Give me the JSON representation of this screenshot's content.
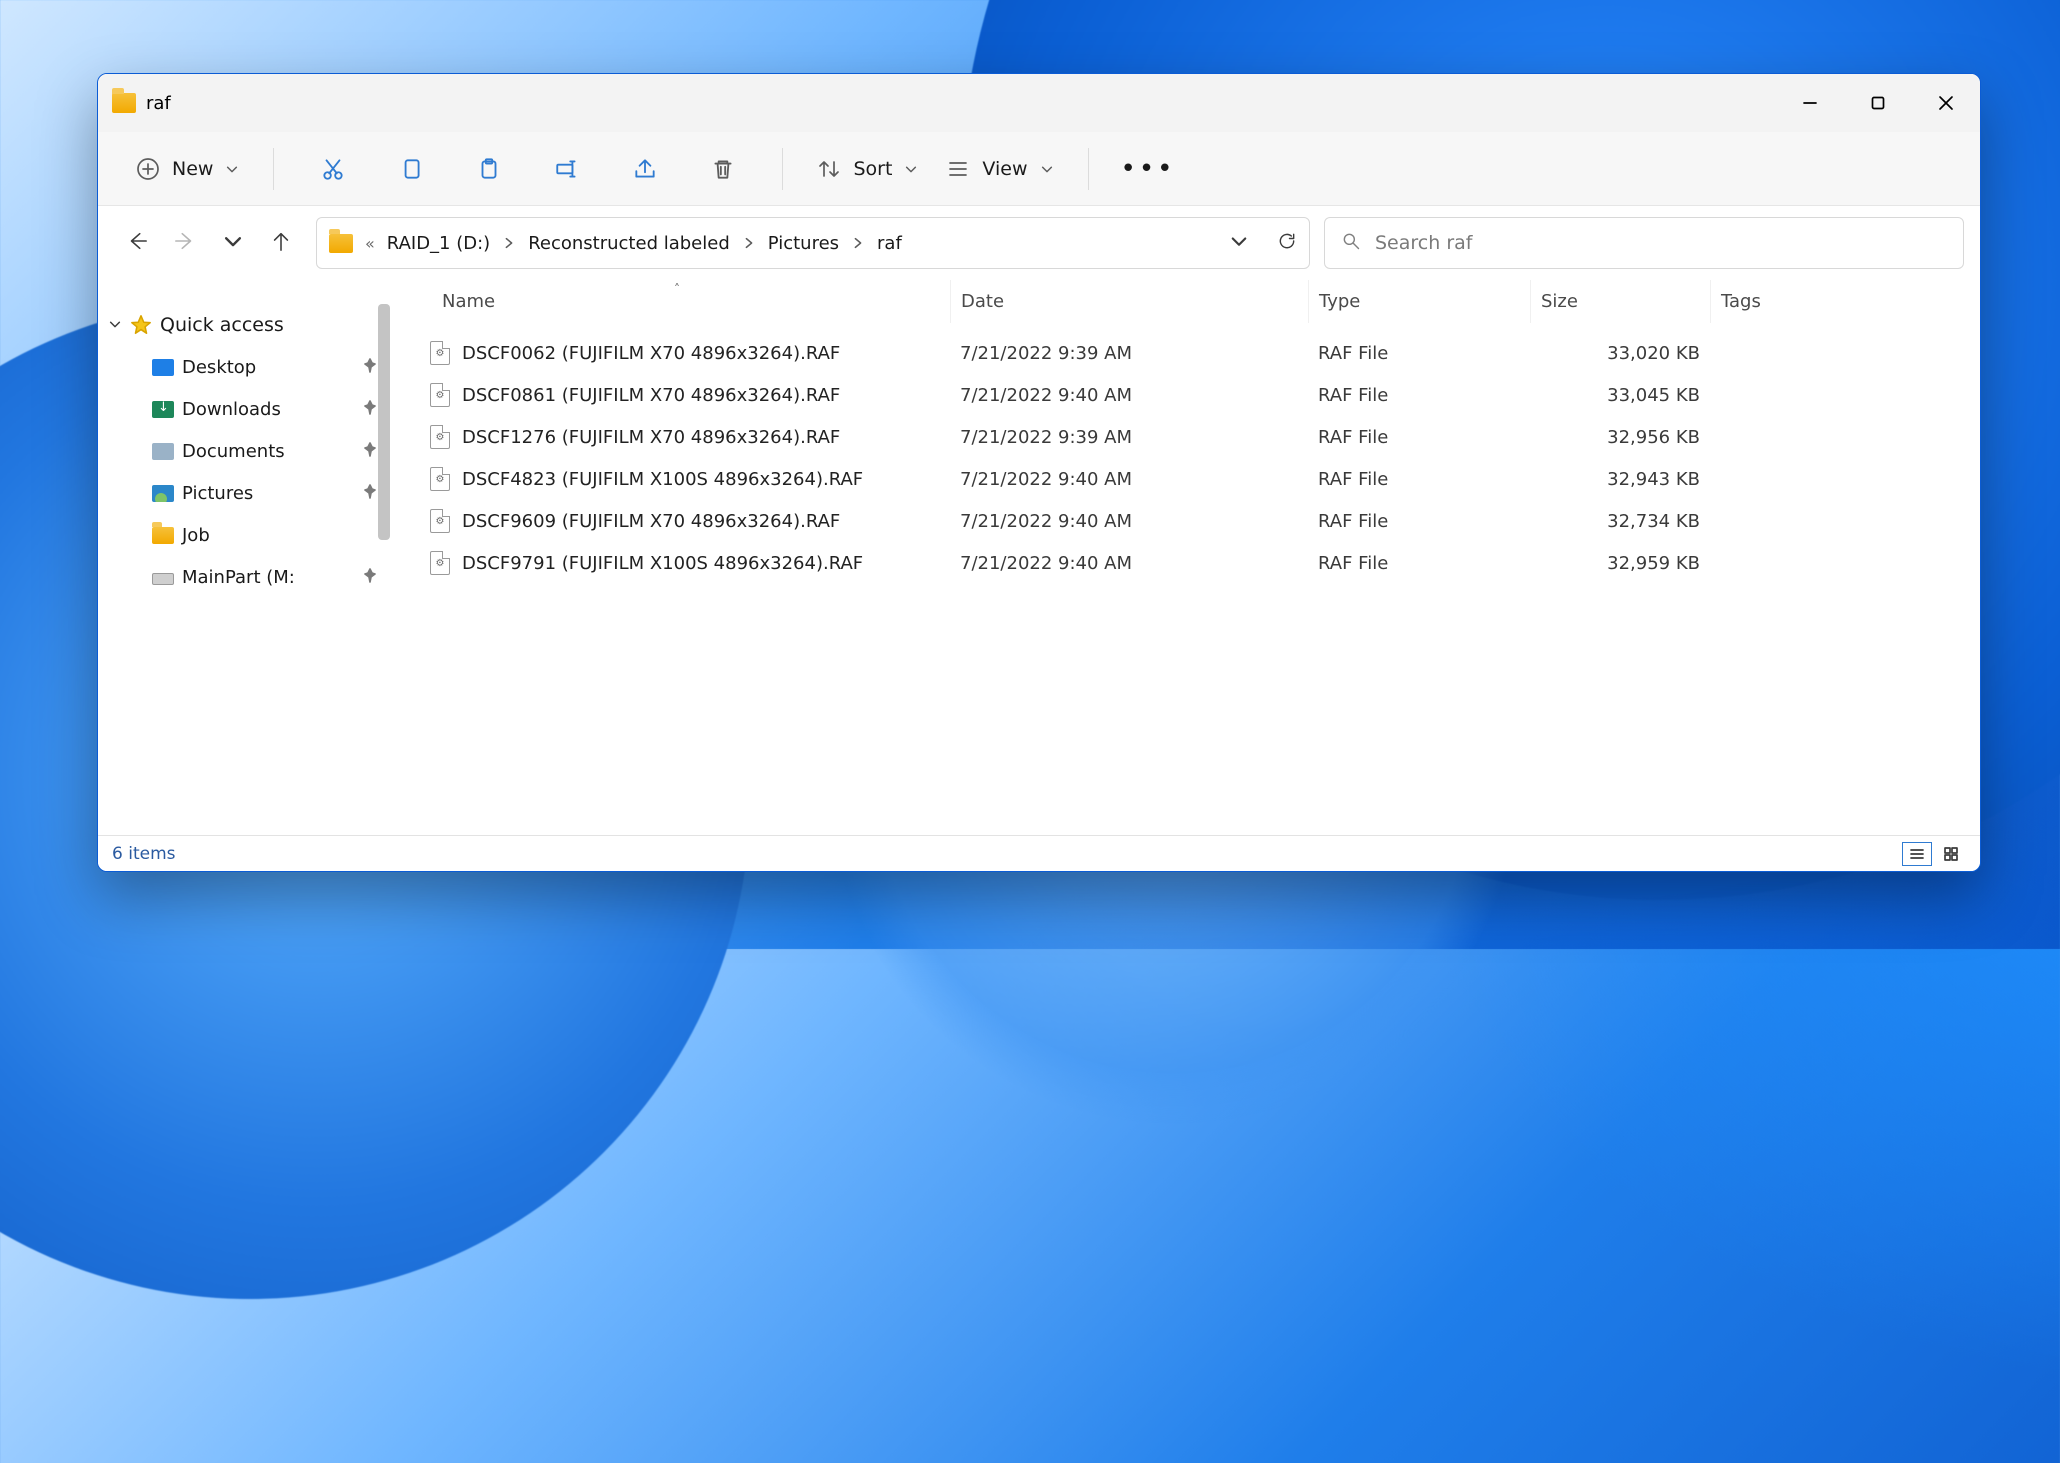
{
  "window": {
    "title": "raf"
  },
  "toolbar": {
    "new_label": "New",
    "sort_label": "Sort",
    "view_label": "View"
  },
  "breadcrumbs": {
    "overflow": "«",
    "segments": [
      "RAID_1 (D:)",
      "Reconstructed labeled",
      "Pictures",
      "raf"
    ]
  },
  "search": {
    "placeholder": "Search raf"
  },
  "sidebar": {
    "root_label": "Quick access",
    "items": [
      {
        "label": "Desktop",
        "pinned": true,
        "icon": "desktop"
      },
      {
        "label": "Downloads",
        "pinned": true,
        "icon": "downloads"
      },
      {
        "label": "Documents",
        "pinned": true,
        "icon": "documents"
      },
      {
        "label": "Pictures",
        "pinned": true,
        "icon": "pictures"
      },
      {
        "label": "Job",
        "pinned": false,
        "icon": "folder"
      },
      {
        "label": "MainPart (M:",
        "pinned": true,
        "icon": "drive"
      }
    ]
  },
  "columns": {
    "name": "Name",
    "date": "Date",
    "type": "Type",
    "size": "Size",
    "tags": "Tags"
  },
  "files": [
    {
      "name": "DSCF0062 (FUJIFILM X70 4896x3264).RAF",
      "date": "7/21/2022 9:39 AM",
      "type": "RAF File",
      "size": "33,020 KB"
    },
    {
      "name": "DSCF0861 (FUJIFILM X70 4896x3264).RAF",
      "date": "7/21/2022 9:40 AM",
      "type": "RAF File",
      "size": "33,045 KB"
    },
    {
      "name": "DSCF1276 (FUJIFILM X70 4896x3264).RAF",
      "date": "7/21/2022 9:39 AM",
      "type": "RAF File",
      "size": "32,956 KB"
    },
    {
      "name": "DSCF4823 (FUJIFILM X100S 4896x3264).RAF",
      "date": "7/21/2022 9:40 AM",
      "type": "RAF File",
      "size": "32,943 KB"
    },
    {
      "name": "DSCF9609 (FUJIFILM X70 4896x3264).RAF",
      "date": "7/21/2022 9:40 AM",
      "type": "RAF File",
      "size": "32,734 KB"
    },
    {
      "name": "DSCF9791 (FUJIFILM X100S 4896x3264).RAF",
      "date": "7/21/2022 9:40 AM",
      "type": "RAF File",
      "size": "32,959 KB"
    }
  ],
  "status": {
    "text": "6 items"
  }
}
